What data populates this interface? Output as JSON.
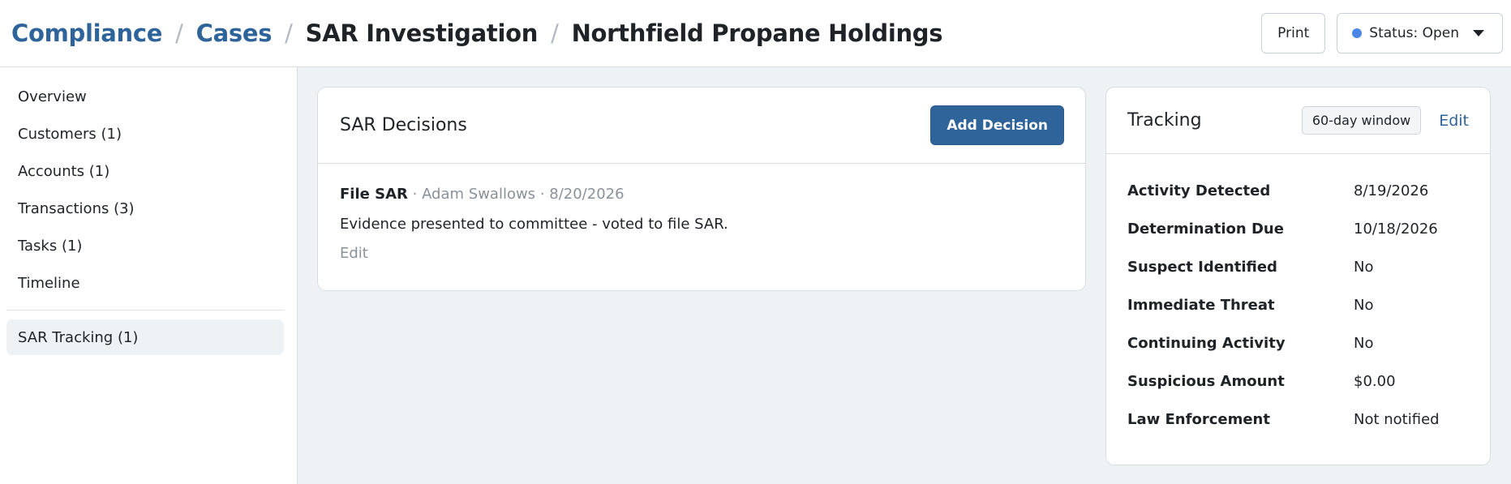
{
  "breadcrumb": {
    "items": [
      "Compliance",
      "Cases",
      "SAR Investigation",
      "Northfield Propane Holdings"
    ],
    "separator": "/"
  },
  "toolbar": {
    "print_label": "Print",
    "status_label": "Status: Open",
    "status_color": "#4a86e8"
  },
  "sidebar": {
    "items": [
      {
        "label": "Overview"
      },
      {
        "label": "Customers (1)"
      },
      {
        "label": "Accounts (1)"
      },
      {
        "label": "Transactions (3)"
      },
      {
        "label": "Tasks (1)"
      },
      {
        "label": "Timeline"
      }
    ],
    "active_item": {
      "label": "SAR Tracking (1)"
    }
  },
  "decisions": {
    "title": "SAR Decisions",
    "add_label": "Add Decision",
    "items": [
      {
        "type": "File SAR",
        "author": "Adam Swallows",
        "date": "8/20/2026",
        "note": "Evidence presented to committee - voted to file SAR.",
        "edit_label": "Edit"
      }
    ]
  },
  "tracking": {
    "title": "Tracking",
    "window_badge": "60-day window",
    "edit_label": "Edit",
    "rows": [
      {
        "label": "Activity Detected",
        "value": "8/19/2026"
      },
      {
        "label": "Determination Due",
        "value": "10/18/2026"
      },
      {
        "label": "Suspect Identified",
        "value": "No"
      },
      {
        "label": "Immediate Threat",
        "value": "No"
      },
      {
        "label": "Continuing Activity",
        "value": "No"
      },
      {
        "label": "Suspicious Amount",
        "value": "$0.00"
      },
      {
        "label": "Law Enforcement",
        "value": "Not notified"
      }
    ]
  },
  "colors": {
    "accent": "#2f649b",
    "background": "#eff2f5"
  }
}
